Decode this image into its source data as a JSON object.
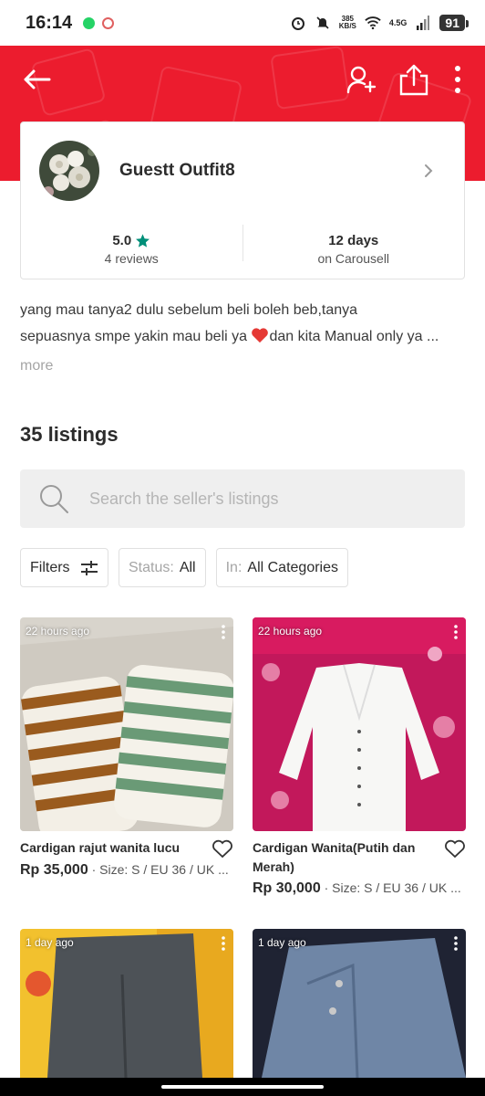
{
  "status_bar": {
    "time": "16:14",
    "net_speed_value": "385",
    "net_speed_unit": "KB/S",
    "network_type": "4.5G",
    "battery": "91"
  },
  "colors": {
    "brand": "#ec1c2e",
    "accent_green": "#008f79"
  },
  "profile": {
    "username": "Guestt Outfit8",
    "rating": "5.0",
    "reviews": "4 reviews",
    "days": "12 days",
    "days_label": "on Carousell"
  },
  "bio": {
    "line1": "yang mau tanya2 dulu sebelum beli boleh beb,tanya",
    "line2_before": "sepuasnya smpe yakin mau beli ya ",
    "line2_after": "dan kita Manual only ya ...",
    "more": "more"
  },
  "listings_count": "35 listings",
  "search": {
    "placeholder": "Search the seller's listings"
  },
  "filters": {
    "filters_label": "Filters",
    "status_label": "Status:",
    "status_value": "All",
    "in_label": "In:",
    "category_value": "All Categories"
  },
  "listings": [
    {
      "time": "22 hours ago",
      "title": "Cardigan rajut wanita lucu",
      "price": "Rp 35,000",
      "details": " · Size: S / EU 36 / UK ..."
    },
    {
      "time": "22 hours ago",
      "title": "Cardigan Wanita(Putih dan Merah)",
      "price": "Rp 30,000",
      "details": " · Size: S / EU 36 / UK ..."
    },
    {
      "time": "1 day ago"
    },
    {
      "time": "1 day ago"
    }
  ]
}
